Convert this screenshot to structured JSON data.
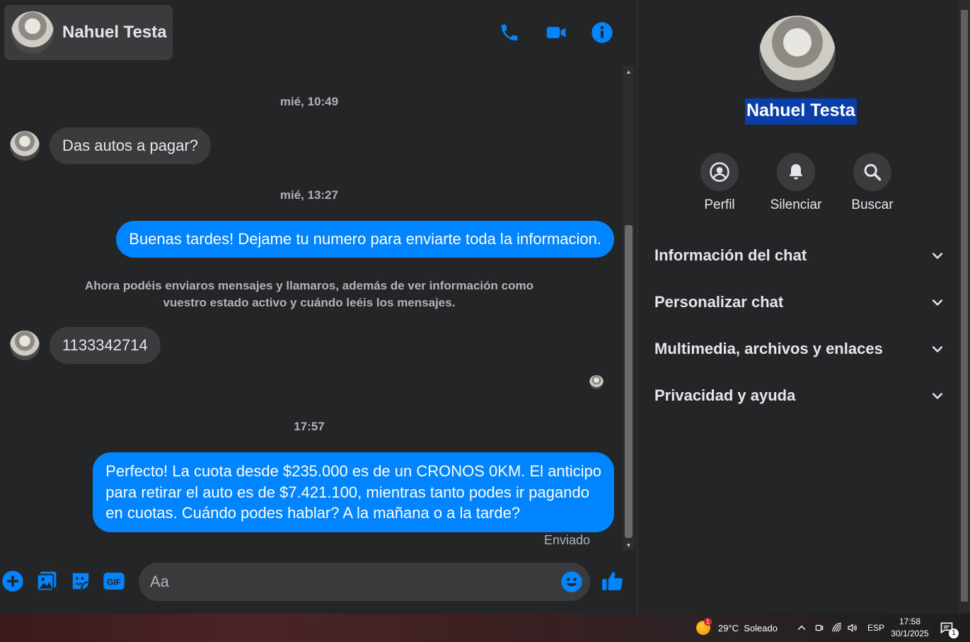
{
  "header": {
    "contact_name": "Nahuel Testa",
    "icons": [
      "phone-icon",
      "video-camera-icon",
      "info-icon"
    ],
    "accent_color": "#0084ff"
  },
  "messages": {
    "ts1": "mié, 10:49",
    "msg1": "Das autos a pagar?",
    "ts2": "mié, 13:27",
    "msg2": "Buenas tardes! Dejame tu numero para enviarte toda la informacion.",
    "system_note_line1": "Ahora podéis enviaros mensajes y llamaros, además de ver información como",
    "system_note_line2": "vuestro estado activo y cuándo leéis los mensajes.",
    "msg3": "1133342714",
    "ts3": "17:57",
    "msg4_line1": "Perfecto! La cuota desde $235.000 es de un CRONOS 0KM. El anticipo",
    "msg4_line2": "para retirar el auto es de $7.421.100, mientras tanto podes ir pagando",
    "msg4_line3": "en cuotas. Cuándo podes hablar? A la mañana o a la tarde?",
    "status": "Enviado"
  },
  "composer": {
    "placeholder": "Aa",
    "icons": [
      "plus-icon",
      "image-icon",
      "sticker-icon",
      "gif-icon",
      "emoji-icon",
      "thumbs-up-icon"
    ],
    "gif_label": "GIF"
  },
  "info_panel": {
    "name": "Nahuel Testa",
    "actions": [
      {
        "label": "Perfil",
        "icon": "profile-icon"
      },
      {
        "label": "Silenciar",
        "icon": "bell-icon"
      },
      {
        "label": "Buscar",
        "icon": "search-icon"
      }
    ],
    "sections": [
      {
        "title": "Información del chat"
      },
      {
        "title": "Personalizar chat"
      },
      {
        "title": "Multimedia, archivos y enlaces"
      },
      {
        "title": "Privacidad y ayuda"
      }
    ]
  },
  "taskbar": {
    "weather_badge": "1",
    "weather": "29°C  Soleado",
    "language": "ESP",
    "time": "17:58",
    "date": "30/1/2025",
    "notification_count": "1"
  }
}
